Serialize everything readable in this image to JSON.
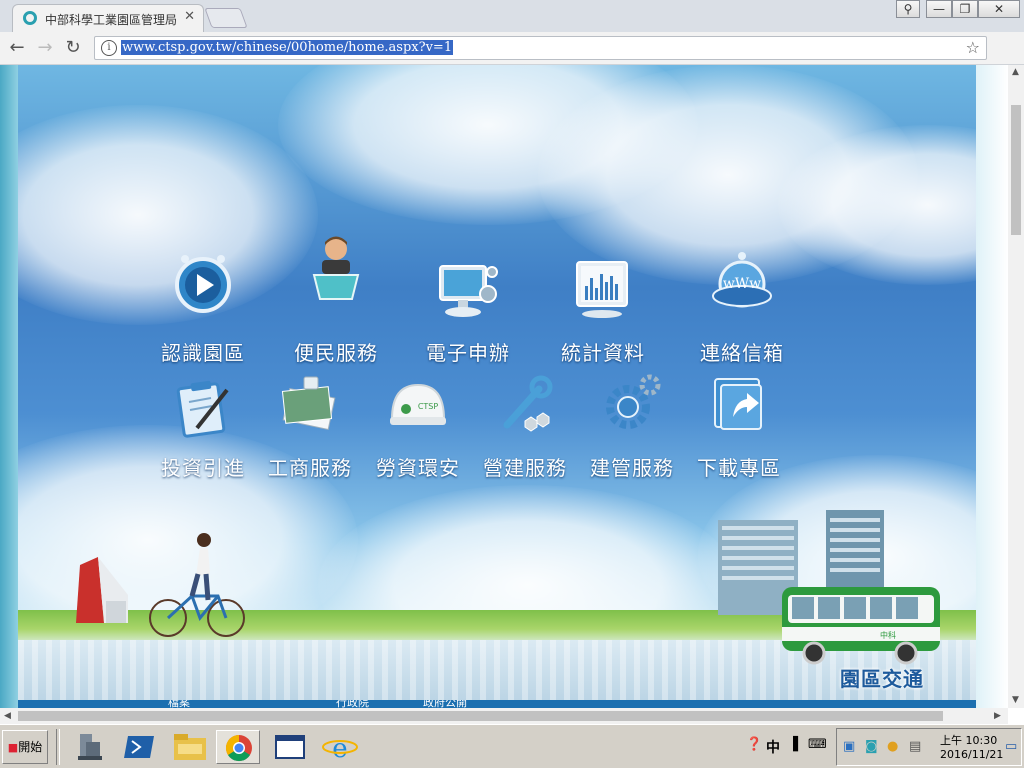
{
  "browser": {
    "tab_title": "中部科學工業園區管理局",
    "tab_close": "✕",
    "url": "www.ctsp.gov.tw/chinese/00home/home.aspx?v=1",
    "back_glyph": "←",
    "forward_glyph": "→",
    "reload_glyph": "↻",
    "star_glyph": "☆",
    "menu_glyph": "⋮",
    "info_glyph": "i",
    "win_user_glyph": "⚲",
    "win_min_glyph": "—",
    "win_max_glyph": "❐",
    "win_close_glyph": "✕"
  },
  "page": {
    "menu_row1": [
      {
        "label": "認識園區",
        "icon": "play-tv-icon"
      },
      {
        "label": "便民服務",
        "icon": "service-clerk-icon"
      },
      {
        "label": "電子申辦",
        "icon": "computer-monitor-icon"
      },
      {
        "label": "統計資料",
        "icon": "chart-monitor-icon"
      },
      {
        "label": "連絡信箱",
        "icon": "www-globe-icon"
      }
    ],
    "menu_row2": [
      {
        "label": "投資引進",
        "icon": "clipboard-pen-icon"
      },
      {
        "label": "工商服務",
        "icon": "documents-cup-icon"
      },
      {
        "label": "勞資環安",
        "icon": "safety-helmet-icon"
      },
      {
        "label": "營建服務",
        "icon": "wrench-bolts-icon"
      },
      {
        "label": "建管服務",
        "icon": "gear-icon"
      },
      {
        "label": "下載專區",
        "icon": "download-folder-icon"
      }
    ],
    "bus_label": "園區交通",
    "bus_sign": "中科",
    "bottom_tabs": [
      "檔案",
      "行政院",
      "政府公開"
    ]
  },
  "taskbar": {
    "start_label": "開始",
    "ime_label": "中",
    "clock_time": "上午 10:30",
    "clock_date": "2016/11/21"
  },
  "colors": {
    "accent": "#3668c6",
    "sky_top": "#6fb7e2",
    "sky_mid": "#3f7fc6",
    "grass": "#7fc04a",
    "bus_green": "#2d9a3e",
    "taskbar": "#d4d0c8"
  }
}
